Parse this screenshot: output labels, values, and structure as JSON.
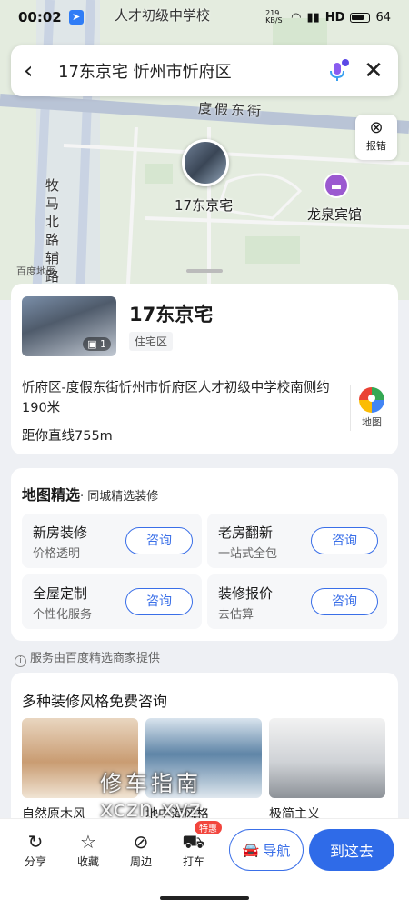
{
  "status_bar": {
    "time": "00:02",
    "speed": "219 KB/S",
    "network": "HD",
    "battery": "64"
  },
  "map": {
    "top_label": "人才初级中学校",
    "road_label": "度假东街",
    "side_road_label": [
      "牧",
      "马",
      "北",
      "路",
      "辅",
      "路"
    ],
    "pin_label": "17东京宅",
    "poi_label": "龙泉宾馆",
    "brand": "百度地图"
  },
  "search": {
    "query": "17东京宅 忻州市忻府区"
  },
  "report_button": {
    "label": "报错"
  },
  "place": {
    "name": "17东京宅",
    "photo_count": "1",
    "category": "住宅区",
    "address": "忻府区-度假东街忻州市忻府区人才初级中学校南侧约190米",
    "distance": "距你直线755m",
    "map_label": "地图"
  },
  "selection": {
    "title": "地图精选",
    "subtitle": "· 同城精选装修",
    "services": [
      {
        "title": "新房装修",
        "subtitle": "价格透明",
        "button": "咨询"
      },
      {
        "title": "老房翻新",
        "subtitle": "一站式全包",
        "button": "咨询"
      },
      {
        "title": "全屋定制",
        "subtitle": "个性化服务",
        "button": "咨询"
      },
      {
        "title": "装修报价",
        "subtitle": "去估算",
        "button": "咨询"
      }
    ]
  },
  "provider_note": "服务由百度精选商家提供",
  "styles_card": {
    "title": "多种装修风格免费咨询",
    "items": [
      {
        "caption": "自然原木风"
      },
      {
        "caption": "地中海风格"
      },
      {
        "caption": "极简主义"
      }
    ]
  },
  "watermark": {
    "line1": "修车指南",
    "line2": "xczn.xyz"
  },
  "bottom_bar": {
    "share": "分享",
    "collect": "收藏",
    "nearby": "周边",
    "taxi": "打车",
    "taxi_badge": "特惠",
    "navigate": "导航",
    "go_here": "到这去"
  },
  "colors": {
    "accent": "#2f6be8",
    "poi": "#9b59d0",
    "badge": "#f2453d"
  }
}
